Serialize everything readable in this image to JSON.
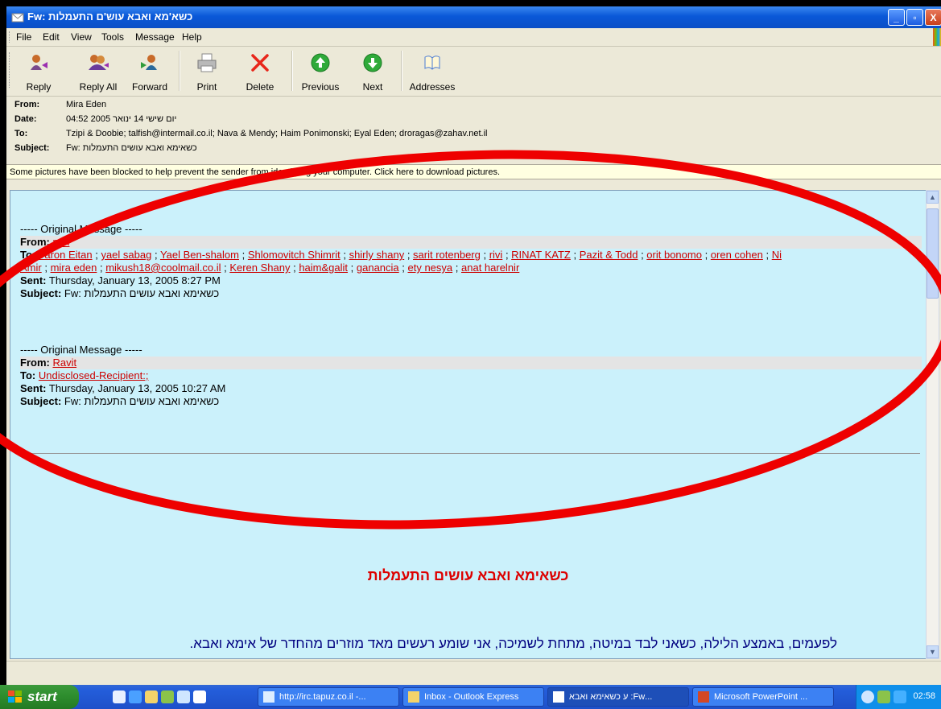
{
  "window": {
    "title": "כשא'מא ואבא עוש'ם התעמלות :Fw",
    "controls": {
      "minimize": "_",
      "maximize": "▫",
      "close": "X"
    }
  },
  "menu": [
    "File",
    "Edit",
    "View",
    "Tools",
    "Message",
    "Help"
  ],
  "toolbar": {
    "reply": "Reply",
    "reply_all": "Reply All",
    "forward": "Forward",
    "print": "Print",
    "delete": "Delete",
    "previous": "Previous",
    "next": "Next",
    "addresses": "Addresses"
  },
  "header": {
    "from_label": "From:",
    "from": "Mira Eden",
    "date_label": "Date:",
    "date": "יום שישי 14 ינואר 2005 04:52",
    "to_label": "To:",
    "to": "Tzipi & Doobie; talfish@intermail.co.il; Nava & Mendy; Haim Ponimonski; Eyal Eden; droragas@zahav.net.il",
    "subject_label": "Subject:",
    "subject": "כשאימא ואבא עושים התעמלות :Fw"
  },
  "infobar": "Some pictures have been blocked to help prevent the sender from identifying your computer. Click here to download pictures.",
  "message1": {
    "original": "----- Original Message -----",
    "from_label": "From:",
    "from": "miri",
    "to_label": "To:",
    "to_line1": [
      "Yaron Eitan",
      "yael sabag",
      "Yael Ben-shalom",
      "Shlomovitch Shimrit",
      "shirly shany",
      "sarit rotenberg",
      "rivi",
      "RINAT KATZ",
      "Pazit & Todd",
      "orit bonomo",
      "oren cohen",
      "Ni"
    ],
    "to_line2": [
      "Amir",
      "mira eden",
      "mikush18@coolmail.co.il",
      "Keren Shany",
      "haim&galit",
      "ganancia",
      "ety nesya",
      "anat harelnir"
    ],
    "sent_label": "Sent:",
    "sent": "Thursday, January 13, 2005 8:27 PM",
    "subject_label": "Subject:",
    "subject": "כשאימא ואבא עושים התעמלות :Fw"
  },
  "message2": {
    "original": "----- Original Message -----",
    "from_label": "From:",
    "from": "Ravit",
    "to_label": "To:",
    "to": "Undisclosed-Recipient:;",
    "sent_label": "Sent:",
    "sent": "Thursday, January 13, 2005 10:27 AM",
    "subject_label": "Subject:",
    "subject": "כשאימא ואבא עושים התעמלות :Fw"
  },
  "body": {
    "heading": "כשאימא ואבא עושים התעמלות",
    "text": "לפעמים, באמצע הלילה, כשאני לבד במיטה, מתחת לשמיכה, אני שומע רעשים מאד מוזרים מהחדר של אימא ואבא."
  },
  "taskbar": {
    "start": "start",
    "tasks": [
      "http://irc.tapuz.co.il -...",
      "Inbox - Outlook Express",
      "...Fw: ע כשאימא ואבא",
      "Microsoft PowerPoint ..."
    ],
    "clock": "02:58"
  },
  "colors": {
    "highlight_ellipse": "#ee0000",
    "content_bg": "#cbf1fb",
    "link": "#cc0000",
    "heading": "#dd0000",
    "body_text": "#000080"
  }
}
